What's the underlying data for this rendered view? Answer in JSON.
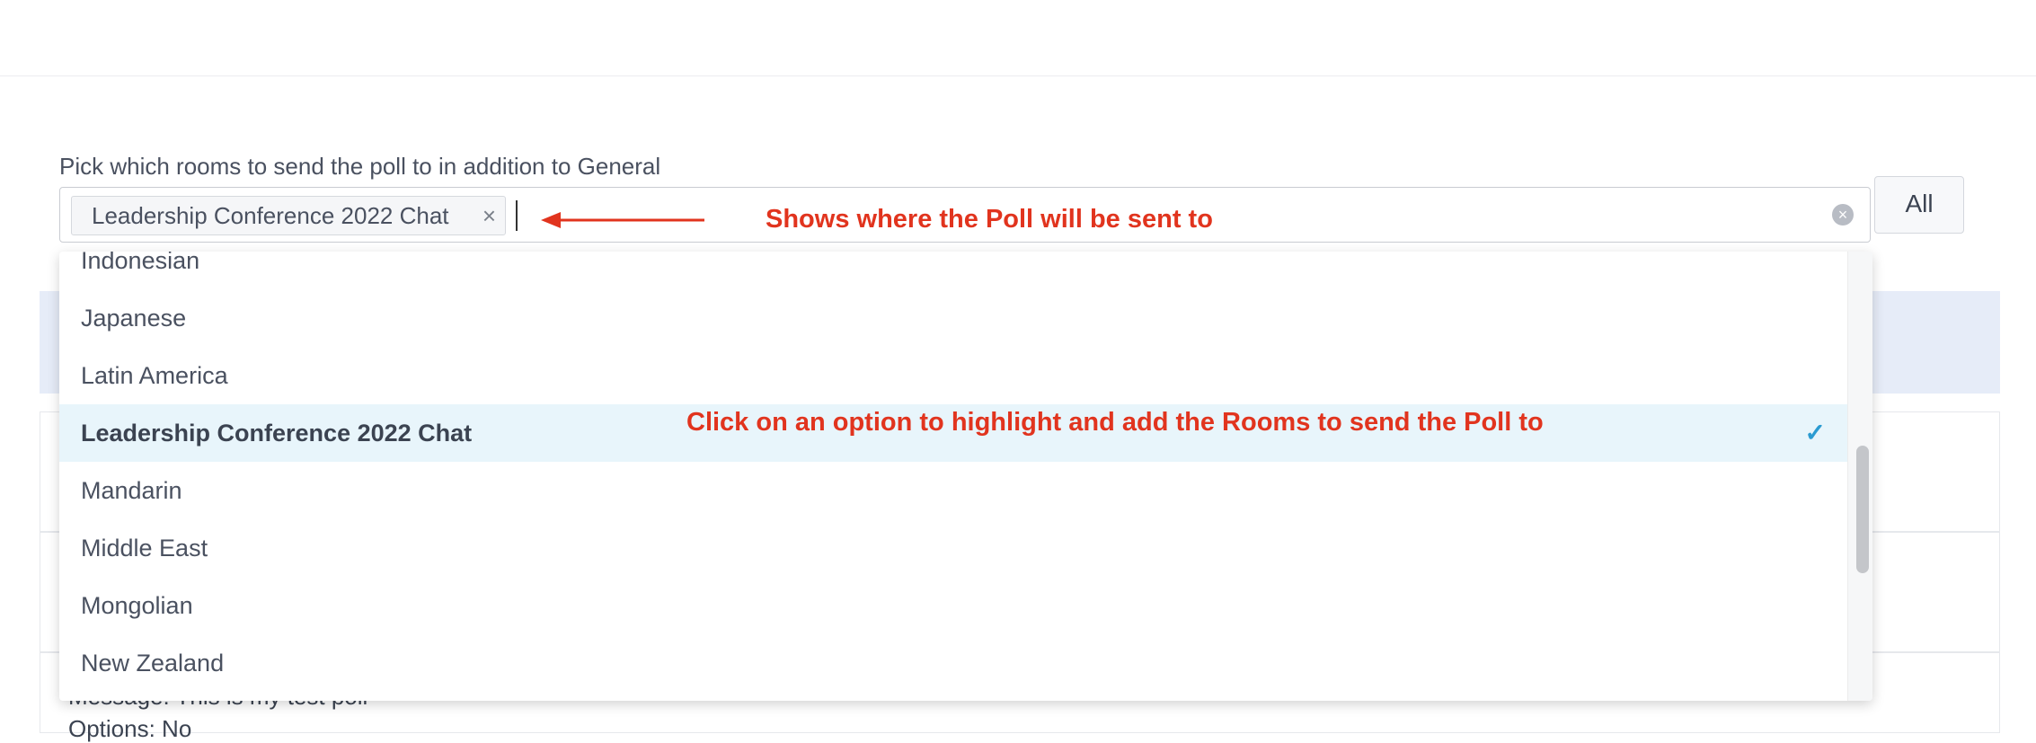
{
  "form": {
    "label": "Pick which rooms to send the poll to in addition to General",
    "selected_chip": "Leadership Conference 2022 Chat",
    "chip_remove": "×",
    "clear_icon": "×",
    "all_button": "All"
  },
  "annotations": {
    "top": "Shows where the Poll will be sent to",
    "middle": "Click on an option to highlight and add the Rooms to send the Poll to",
    "color": "#e1341e"
  },
  "dropdown": {
    "options": [
      "Indonesian",
      "Japanese",
      "Latin America",
      "Leadership Conference 2022 Chat",
      "Mandarin",
      "Middle East",
      "Mongolian",
      "New Zealand"
    ],
    "selected_index": 3,
    "check_icon": "✓"
  },
  "background": {
    "partial_text": "Message: This is my test poll",
    "partial_text2": "Options: No"
  }
}
